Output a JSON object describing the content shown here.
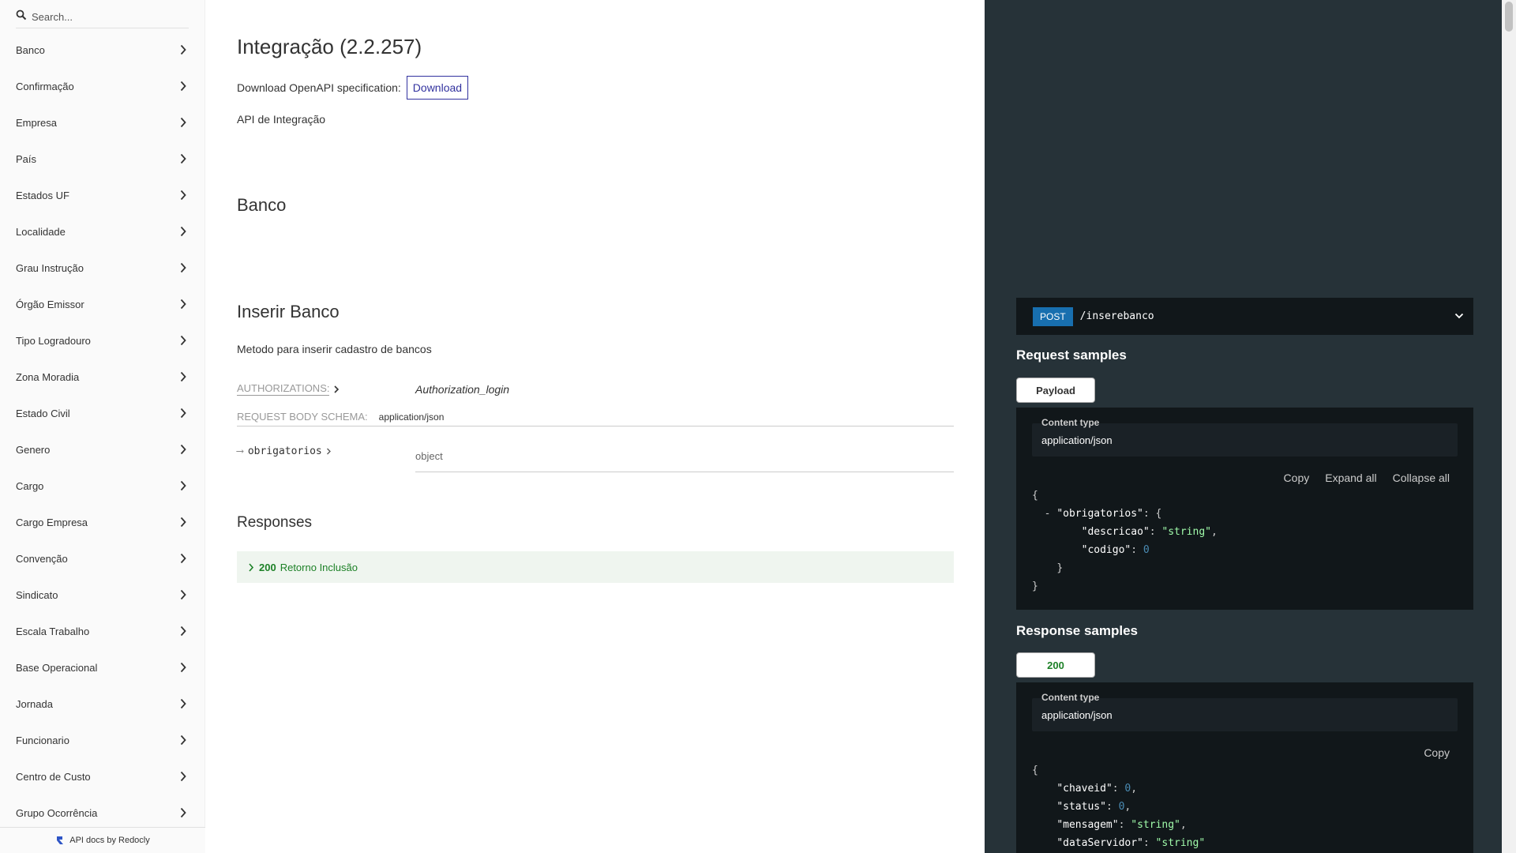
{
  "search": {
    "placeholder": "Search..."
  },
  "sidebar": {
    "items": [
      {
        "label": "Banco"
      },
      {
        "label": "Confirmação"
      },
      {
        "label": "Empresa"
      },
      {
        "label": "País"
      },
      {
        "label": "Estados UF"
      },
      {
        "label": "Localidade"
      },
      {
        "label": "Grau Instrução"
      },
      {
        "label": "Órgão Emissor"
      },
      {
        "label": "Tipo Logradouro"
      },
      {
        "label": "Zona Moradia"
      },
      {
        "label": "Estado Civil"
      },
      {
        "label": "Genero"
      },
      {
        "label": "Cargo"
      },
      {
        "label": "Cargo Empresa"
      },
      {
        "label": "Convenção"
      },
      {
        "label": "Sindicato"
      },
      {
        "label": "Escala Trabalho"
      },
      {
        "label": "Base Operacional"
      },
      {
        "label": "Jornada"
      },
      {
        "label": "Funcionario"
      },
      {
        "label": "Centro de Custo"
      },
      {
        "label": "Grupo Ocorrência"
      }
    ],
    "footer": "API docs by Redocly"
  },
  "main": {
    "title": "Integração (2.2.257)",
    "download_label": "Download OpenAPI specification:",
    "download_button": "Download",
    "description": "API de Integração",
    "section_banco": "Banco",
    "operation_title": "Inserir Banco",
    "operation_desc": "Metodo para inserir cadastro de bancos",
    "auth_label": "AUTHORIZATIONS:",
    "auth_value": "Authorization_login",
    "schema_label": "REQUEST BODY SCHEMA:",
    "schema_ct": "application/json",
    "prop_name": "obrigatorios",
    "prop_type": "object",
    "responses_title": "Responses",
    "response_code": "200",
    "response_desc": "Retorno Inclusão"
  },
  "right": {
    "method": "POST",
    "path": "/inserebanco",
    "request_title": "Request samples",
    "request_tab": "Payload",
    "content_type_label": "Content type",
    "content_type_value": "application/json",
    "copy": "Copy",
    "expand_all": "Expand all",
    "collapse_all": "Collapse all",
    "request_keys": {
      "obrigatorios": "\"obrigatorios\"",
      "descricao": "\"descricao\"",
      "descricao_val": "\"string\"",
      "codigo": "\"codigo\"",
      "codigo_val": "0"
    },
    "response_title": "Response samples",
    "response_tab": "200",
    "response_keys": {
      "chaveid": "\"chaveid\"",
      "chaveid_val": "0",
      "status": "\"status\"",
      "status_val": "0",
      "mensagem": "\"mensagem\"",
      "mensagem_val": "\"string\"",
      "dataServidor": "\"dataServidor\"",
      "dataServidor_val": "\"string\""
    },
    "colors": {
      "bg": "#263238",
      "string": "#a0fbaa",
      "number": "#4a8bb3",
      "post": "#186faf",
      "success": "#1d8127"
    }
  }
}
